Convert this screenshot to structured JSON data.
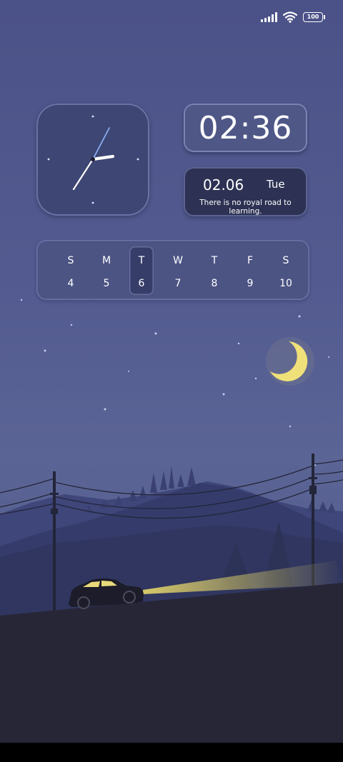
{
  "status_bar": {
    "battery": "100",
    "icons": [
      "signal-icon",
      "wifi-icon",
      "battery-icon"
    ]
  },
  "clock": {
    "digital_time": "02:36",
    "date": "02.06",
    "weekday": "Tue",
    "quote": "There is no royal road to learning."
  },
  "calendar": {
    "days": [
      {
        "name": "S",
        "date": "4"
      },
      {
        "name": "M",
        "date": "5"
      },
      {
        "name": "T",
        "date": "6"
      },
      {
        "name": "W",
        "date": "7"
      },
      {
        "name": "T",
        "date": "8"
      },
      {
        "name": "F",
        "date": "9"
      },
      {
        "name": "S",
        "date": "10"
      }
    ],
    "today_index": 2
  },
  "colors": {
    "sky": "#535b90",
    "ground": "#272637",
    "moon": "#efe07a",
    "headlight": "#e9d96a"
  }
}
